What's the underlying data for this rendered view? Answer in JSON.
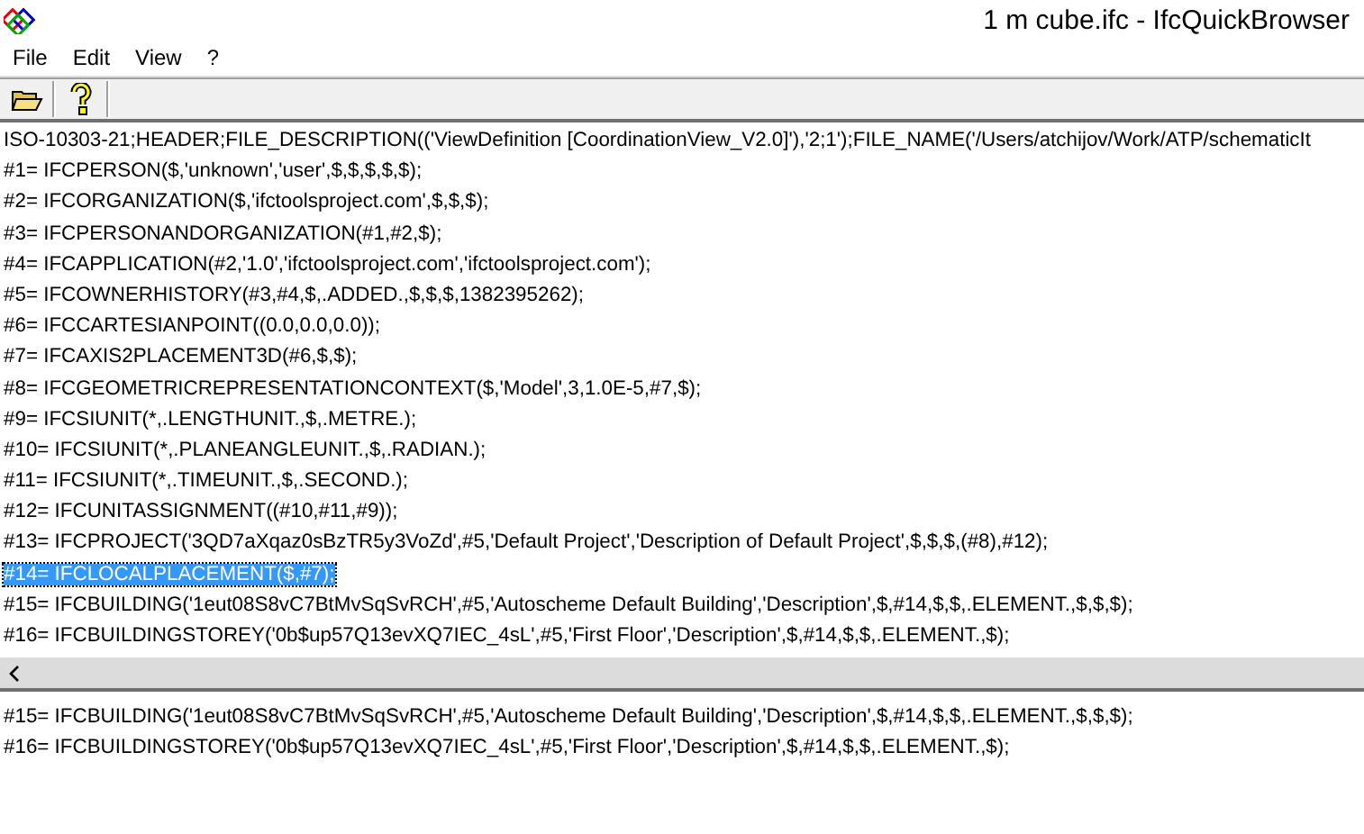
{
  "window": {
    "title": "1 m cube.ifc - IfcQuickBrowser"
  },
  "menu": [
    "File",
    "Edit",
    "View",
    "?"
  ],
  "source_pane": {
    "lines": [
      {
        "text": "ISO-10303-21;HEADER;FILE_DESCRIPTION(('ViewDefinition [CoordinationView_V2.0]'),'2;1');FILE_NAME('/Users/atchijov/Work/ATP/schematicIt",
        "selected": false
      },
      {
        "text": "#1= IFCPERSON($,'unknown','user',$,$,$,$,$);",
        "selected": false
      },
      {
        "text": "#2= IFCORGANIZATION($,'ifctoolsproject.com',$,$,$);",
        "selected": false
      },
      {
        "text": "#3= IFCPERSONANDORGANIZATION(#1,#2,$);",
        "selected": false
      },
      {
        "text": "#4= IFCAPPLICATION(#2,'1.0','ifctoolsproject.com','ifctoolsproject.com');",
        "selected": false
      },
      {
        "text": "#5= IFCOWNERHISTORY(#3,#4,$,.ADDED.,$,$,$,1382395262);",
        "selected": false
      },
      {
        "text": "#6= IFCCARTESIANPOINT((0.0,0.0,0.0));",
        "selected": false
      },
      {
        "text": "#7= IFCAXIS2PLACEMENT3D(#6,$,$);",
        "selected": false
      },
      {
        "text": "#8= IFCGEOMETRICREPRESENTATIONCONTEXT($,'Model',3,1.0E-5,#7,$);",
        "selected": false
      },
      {
        "text": "#9= IFCSIUNIT(*,.LENGTHUNIT.,$,.METRE.);",
        "selected": false
      },
      {
        "text": "#10= IFCSIUNIT(*,.PLANEANGLEUNIT.,$,.RADIAN.);",
        "selected": false
      },
      {
        "text": "#11= IFCSIUNIT(*,.TIMEUNIT.,$,.SECOND.);",
        "selected": false
      },
      {
        "text": "#12= IFCUNITASSIGNMENT((#10,#11,#9));",
        "selected": false
      },
      {
        "text": "#13= IFCPROJECT('3QD7aXqaz0sBzTR5y3VoZd',#5,'Default Project','Description of Default Project',$,$,$,(#8),#12);",
        "selected": false
      },
      {
        "text": "#14= IFCLOCALPLACEMENT($,#7);",
        "selected": true
      },
      {
        "text": "#15= IFCBUILDING('1eut08S8vC7BtMvSqSvRCH',#5,'Autoscheme Default Building','Description',$,#14,$,$,.ELEMENT.,$,$,$);",
        "selected": false
      },
      {
        "text": "#16= IFCBUILDINGSTOREY('0b$up57Q13evXQ7IEC_4sL',#5,'First Floor','Description',$,#14,$,$,.ELEMENT.,$);",
        "selected": false
      }
    ]
  },
  "reference_pane": {
    "lines": [
      {
        "text": "#15= IFCBUILDING('1eut08S8vC7BtMvSqSvRCH',#5,'Autoscheme Default Building','Description',$,#14,$,$,.ELEMENT.,$,$,$);",
        "selected": false
      },
      {
        "text": "#16= IFCBUILDINGSTOREY('0b$up57Q13evXQ7IEC_4sL',#5,'First Floor','Description',$,#14,$,$,.ELEMENT.,$);",
        "selected": false
      }
    ]
  }
}
